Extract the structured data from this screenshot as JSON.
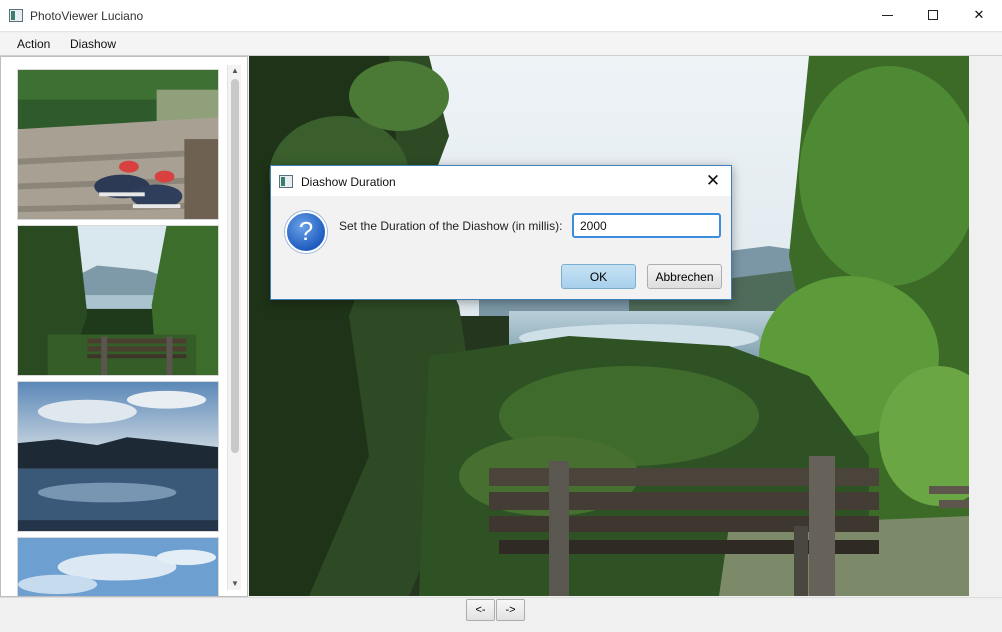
{
  "window": {
    "title": "PhotoViewer Luciano",
    "minimize": "",
    "maximize": "",
    "close": "✕"
  },
  "menu": {
    "action": "Action",
    "diashow": "Diashow"
  },
  "sidebar": {
    "thumbnails": [
      {
        "icon": "photo-shoes-on-boardwalk"
      },
      {
        "icon": "photo-bench-lake-view"
      },
      {
        "icon": "photo-lake-mountains-dusk"
      },
      {
        "icon": "photo-sky-clouds"
      }
    ],
    "scroll_up": "▲",
    "scroll_down": "▼"
  },
  "navigation": {
    "prev_label": "<-",
    "next_label": "->"
  },
  "dialog": {
    "title": "Diashow Duration",
    "close": "✕",
    "icon": "question-icon",
    "icon_glyph": "?",
    "message": "Set the Duration of the Diashow (in millis):",
    "input_value": "2000",
    "ok_label": "OK",
    "cancel_label": "Abbrechen"
  },
  "colors": {
    "dialog_border": "#3f7fb9",
    "ok_button": "#b9dbf1",
    "input_focus": "#3c8ddb"
  }
}
